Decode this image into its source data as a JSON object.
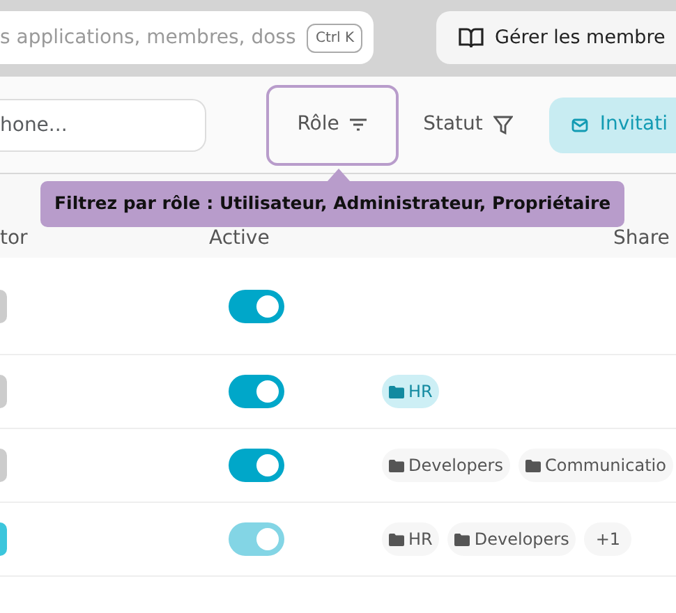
{
  "top_bar": {
    "search": {
      "placeholder": "s applications, membres, doss",
      "shortcut": "Ctrl K"
    },
    "manage_button": "Gérer les membre"
  },
  "toolbar": {
    "search": {
      "placeholder": "hone..."
    },
    "role_filter": {
      "label": "Rôle",
      "focused": true
    },
    "status_filter": {
      "label": "Statut"
    },
    "invite_button": "Invitati"
  },
  "tooltip": "Filtrez par rôle : Utilisateur, Administrateur, Propriétaire",
  "table": {
    "columns": [
      "tor",
      "Active",
      "Share"
    ],
    "rows": [
      {
        "column_1_on": false,
        "active": {
          "on": true,
          "disabled": false
        },
        "tags": []
      },
      {
        "column_1_on": false,
        "active": {
          "on": true,
          "disabled": false
        },
        "tags": [
          {
            "kind": "folder",
            "label": "HR",
            "highlighted": true
          }
        ]
      },
      {
        "column_1_on": false,
        "active": {
          "on": true,
          "disabled": false
        },
        "tags": [
          {
            "kind": "folder",
            "label": "Developers",
            "highlighted": false
          },
          {
            "kind": "folder",
            "label": "Communicatio",
            "highlighted": false
          }
        ]
      },
      {
        "column_1_on": true,
        "active": {
          "on": true,
          "disabled": true
        },
        "tags": [
          {
            "kind": "folder",
            "label": "HR",
            "highlighted": false
          },
          {
            "kind": "folder",
            "label": "Developers",
            "highlighted": false
          },
          {
            "kind": "count",
            "label": "+1",
            "highlighted": false
          }
        ]
      }
    ]
  }
}
